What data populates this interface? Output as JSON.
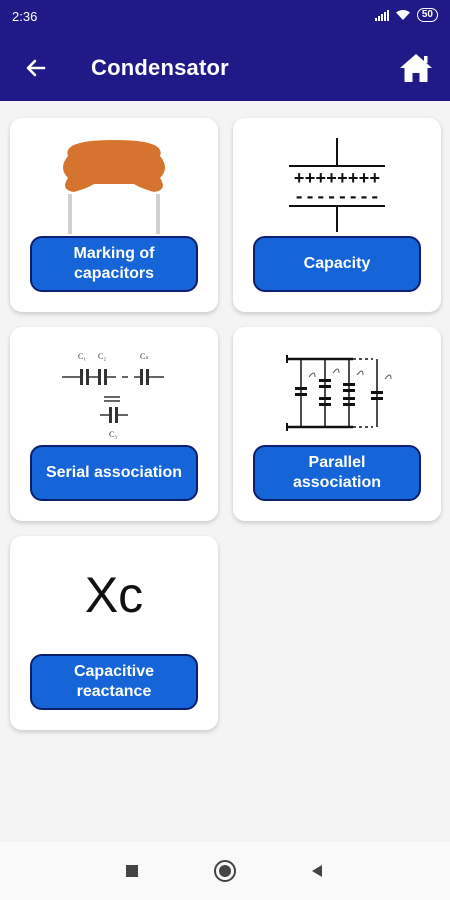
{
  "status_bar": {
    "time": "2:36",
    "battery": "50"
  },
  "header": {
    "title": "Condensator",
    "back_icon": "arrow-left-icon",
    "home_icon": "home-icon"
  },
  "cards": [
    {
      "label": "Marking of\ncapacitors",
      "icon": "ceramic-capacitor-image"
    },
    {
      "label": "Capacity",
      "icon": "capacitor-plates-image"
    },
    {
      "label": "Serial association",
      "icon": "series-capacitors-image"
    },
    {
      "label": "Parallel\nassociation",
      "icon": "parallel-capacitors-image"
    },
    {
      "label": "Capacitive\nreactance",
      "icon": "xc-text-image",
      "image_text": "Xc"
    }
  ],
  "diagram_labels": {
    "c1": "C₁",
    "c2": "C₂",
    "cs": "Cₛ",
    "c3": "C₃"
  },
  "nav_bar": {
    "recents_icon": "square-icon",
    "home_icon": "circle-icon",
    "back_icon": "triangle-back-icon"
  },
  "colors": {
    "app_bar": "#1f1a87",
    "button": "#1565d8",
    "button_border": "#0b1f6e",
    "capacitor_body": "#d5732f"
  }
}
